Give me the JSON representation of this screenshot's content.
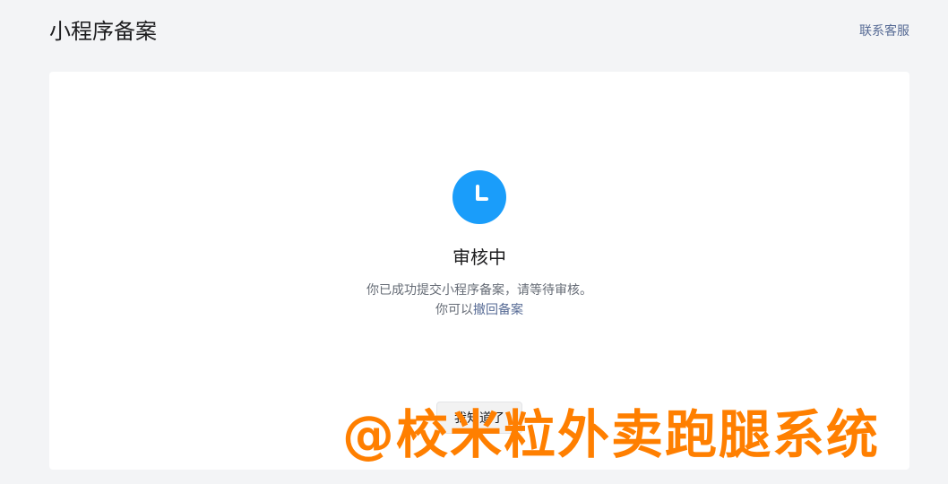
{
  "header": {
    "title": "小程序备案",
    "contact_label": "联系客服"
  },
  "status": {
    "icon": "clock-icon",
    "icon_color": "#1a9dfa",
    "title": "审核中",
    "description": "你已成功提交小程序备案，请等待审核。",
    "withdraw_prefix": "你可以",
    "withdraw_link": "撤回备案"
  },
  "actions": {
    "acknowledge_label": "我知道了"
  },
  "watermark": {
    "text": "@校米粒外卖跑腿系统",
    "color": "#ff7f00"
  }
}
